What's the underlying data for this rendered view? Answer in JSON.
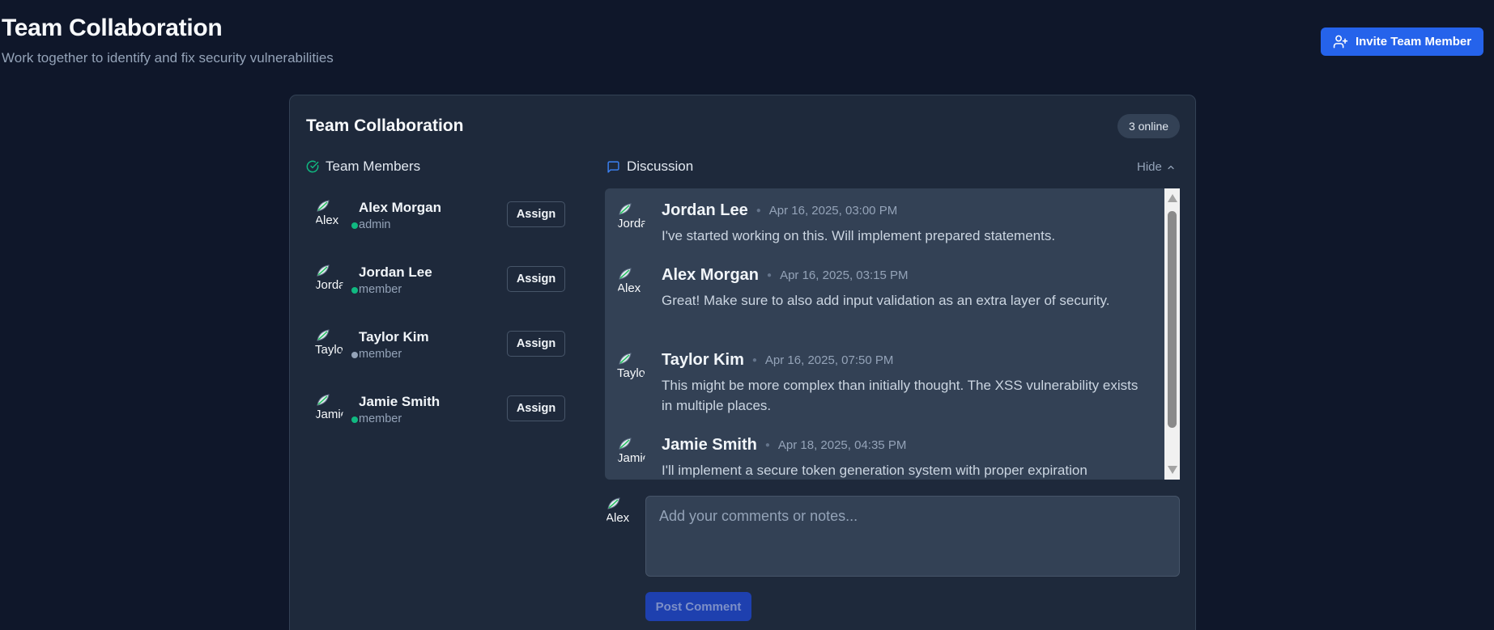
{
  "header": {
    "title": "Team Collaboration",
    "subtitle": "Work together to identify and fix security vulnerabilities",
    "invite_label": "Invite Team Member"
  },
  "card": {
    "title": "Team Collaboration",
    "online_badge": "3 online"
  },
  "members_section": {
    "title": "Team Members",
    "assign_label": "Assign",
    "members": [
      {
        "name": "Alex Morgan",
        "role": "admin",
        "status": "online",
        "avatar_alt": "Alex"
      },
      {
        "name": "Jordan Lee",
        "role": "member",
        "status": "online",
        "avatar_alt": "Jordan"
      },
      {
        "name": "Taylor Kim",
        "role": "member",
        "status": "offline",
        "avatar_alt": "Taylor"
      },
      {
        "name": "Jamie Smith",
        "role": "member",
        "status": "online",
        "avatar_alt": "Jamie"
      }
    ]
  },
  "discussion": {
    "title": "Discussion",
    "toggle_label": "Hide",
    "comments": [
      {
        "author": "Jordan Lee",
        "avatar_alt": "Jordan",
        "time": "Apr 16, 2025, 03:00 PM",
        "text": "I've started working on this. Will implement prepared statements."
      },
      {
        "author": "Alex Morgan",
        "avatar_alt": "Alex",
        "time": "Apr 16, 2025, 03:15 PM",
        "text": "Great! Make sure to also add input validation as an extra layer of security."
      },
      {
        "author": "Taylor Kim",
        "avatar_alt": "Taylor",
        "time": "Apr 16, 2025, 07:50 PM",
        "text": "This might be more complex than initially thought. The XSS vulnerability exists in multiple places."
      },
      {
        "author": "Jamie Smith",
        "avatar_alt": "Jamie",
        "time": "Apr 18, 2025, 04:35 PM",
        "text": "I'll implement a secure token generation system with proper expiration"
      }
    ],
    "compose_avatar_alt": "Alex",
    "input_placeholder": "Add your comments or notes...",
    "post_label": "Post Comment"
  },
  "colors": {
    "accent": "#2563eb",
    "online": "#10b981",
    "offline": "#94a3b8",
    "background": "#0f172a",
    "card": "#1e293b"
  },
  "icons": {
    "invite": "user-plus-icon",
    "members": "check-circle-icon",
    "discussion": "message-square-icon",
    "toggle": "chevron-up-icon",
    "avatar": "broken-image-icon"
  }
}
